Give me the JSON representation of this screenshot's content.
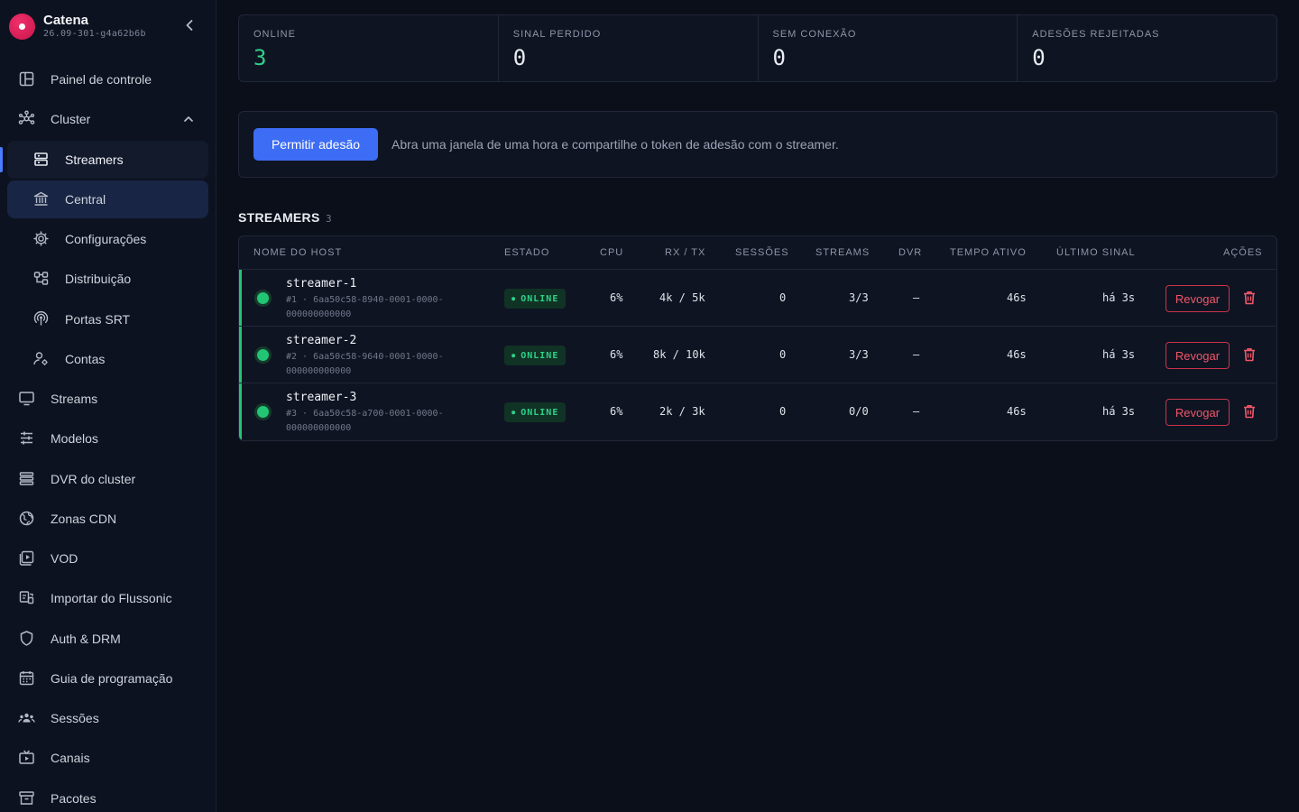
{
  "brand": {
    "name": "Catena",
    "version": "26.09-301-g4a62b6b"
  },
  "nav": {
    "dashboard": "Painel de controle",
    "cluster": "Cluster",
    "streamers": "Streamers",
    "central": "Central",
    "config": "Configurações",
    "distribution": "Distribuição",
    "srt_ports": "Portas SRT",
    "accounts": "Contas",
    "streams": "Streams",
    "templates": "Modelos",
    "cluster_dvr": "DVR do cluster",
    "cdn_zones": "Zonas CDN",
    "vod": "VOD",
    "flussonic_import": "Importar do Flussonic",
    "auth_drm": "Auth & DRM",
    "epg": "Guia de programação",
    "sessions": "Sessões",
    "channels": "Canais",
    "packages": "Pacotes"
  },
  "stats": [
    {
      "label": "ONLINE",
      "value": "3"
    },
    {
      "label": "SINAL PERDIDO",
      "value": "0"
    },
    {
      "label": "SEM CONEXÃO",
      "value": "0"
    },
    {
      "label": "ADESÕES REJEITADAS",
      "value": "0"
    }
  ],
  "join": {
    "button": "Permitir adesão",
    "text": "Abra uma janela de uma hora e compartilhe o token de adesão com o streamer."
  },
  "section": {
    "title": "STREAMERS",
    "count": "3"
  },
  "table": {
    "headers": {
      "host": "NOME DO HOST",
      "state": "ESTADO",
      "cpu": "CPU",
      "rxtx": "RX / TX",
      "sessions": "SESSÕES",
      "streams": "STREAMS",
      "dvr": "DVR",
      "uptime": "TEMPO ATIVO",
      "last_signal": "ÚLTIMO SINAL",
      "actions": "AÇÕES"
    },
    "rows": [
      {
        "host": "streamer-1",
        "id_line1": "#1 · 6aa50c58-8940-0001-0000-",
        "id_line2": "000000000000",
        "state": "ONLINE",
        "cpu": "6%",
        "rxtx": "4k / 5k",
        "sessions": "0",
        "streams": "3/3",
        "dvr": "—",
        "uptime": "46s",
        "last_signal": "há 3s",
        "revoke": "Revogar"
      },
      {
        "host": "streamer-2",
        "id_line1": "#2 · 6aa50c58-9640-0001-0000-",
        "id_line2": "000000000000",
        "state": "ONLINE",
        "cpu": "6%",
        "rxtx": "8k / 10k",
        "sessions": "0",
        "streams": "3/3",
        "dvr": "—",
        "uptime": "46s",
        "last_signal": "há 3s",
        "revoke": "Revogar"
      },
      {
        "host": "streamer-3",
        "id_line1": "#3 · 6aa50c58-a700-0001-0000-",
        "id_line2": "000000000000",
        "state": "ONLINE",
        "cpu": "6%",
        "rxtx": "2k / 3k",
        "sessions": "0",
        "streams": "0/0",
        "dvr": "—",
        "uptime": "46s",
        "last_signal": "há 3s",
        "revoke": "Revogar"
      }
    ]
  }
}
